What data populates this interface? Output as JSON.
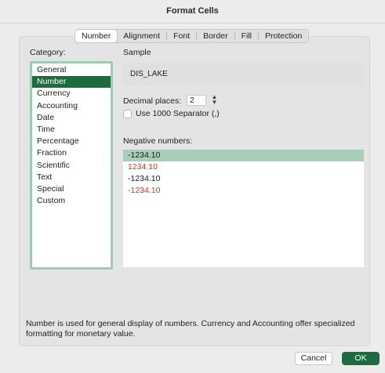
{
  "window": {
    "title": "Format Cells"
  },
  "tabs": [
    {
      "label": "Number",
      "active": true
    },
    {
      "label": "Alignment",
      "active": false
    },
    {
      "label": "Font",
      "active": false
    },
    {
      "label": "Border",
      "active": false
    },
    {
      "label": "Fill",
      "active": false
    },
    {
      "label": "Protection",
      "active": false
    }
  ],
  "category": {
    "label": "Category:",
    "selected": "Number",
    "items": [
      "General",
      "Number",
      "Currency",
      "Accounting",
      "Date",
      "Time",
      "Percentage",
      "Fraction",
      "Scientific",
      "Text",
      "Special",
      "Custom"
    ]
  },
  "sample": {
    "label": "Sample",
    "value": "DIS_LAKE"
  },
  "decimal": {
    "label": "Decimal places:",
    "value": "2"
  },
  "separator": {
    "label": "Use 1000 Separator (,)",
    "checked": false
  },
  "negative": {
    "label": "Negative numbers:",
    "items": [
      {
        "text": "-1234.10",
        "color": "#1e1e1e",
        "selected": true
      },
      {
        "text": "1234.10",
        "color": "#e0301e",
        "selected": false
      },
      {
        "text": "-1234.10",
        "color": "#1e1e1e",
        "selected": false
      },
      {
        "text": "-1234.10",
        "color": "#e0301e",
        "selected": false
      }
    ]
  },
  "description": "Number is used for general display of numbers.  Currency and Accounting offer specialized formatting for monetary value.",
  "buttons": {
    "cancel": "Cancel",
    "ok": "OK"
  },
  "colors": {
    "accent": "#1d6b3e",
    "list_border": "#9ccfaf",
    "negative_red": "#e0301e",
    "negative_selected": "#a7cfb7"
  }
}
